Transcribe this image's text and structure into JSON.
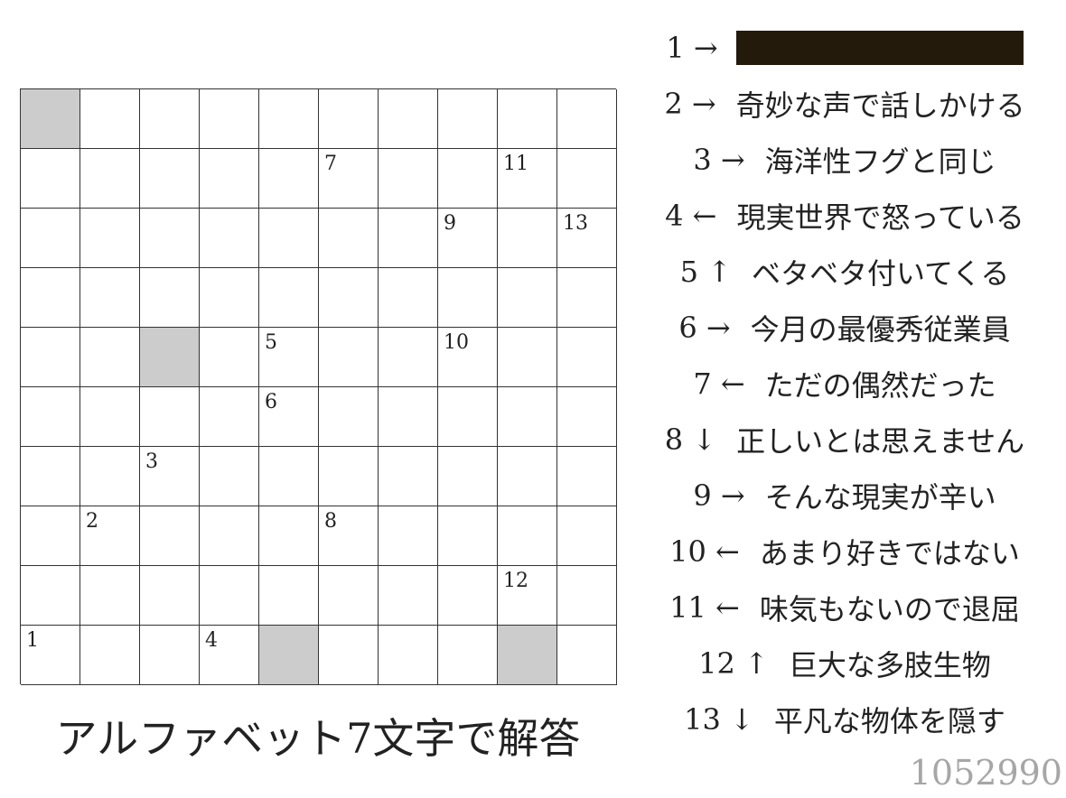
{
  "puzzle": {
    "rows": 10,
    "cols": 10,
    "blocked": [
      [
        0,
        0
      ],
      [
        4,
        2
      ],
      [
        9,
        4
      ],
      [
        9,
        8
      ]
    ],
    "numbers": [
      {
        "r": 1,
        "c": 5,
        "n": "7"
      },
      {
        "r": 1,
        "c": 8,
        "n": "11"
      },
      {
        "r": 2,
        "c": 7,
        "n": "9"
      },
      {
        "r": 2,
        "c": 9,
        "n": "13"
      },
      {
        "r": 4,
        "c": 4,
        "n": "5"
      },
      {
        "r": 4,
        "c": 7,
        "n": "10"
      },
      {
        "r": 5,
        "c": 4,
        "n": "6"
      },
      {
        "r": 6,
        "c": 2,
        "n": "3"
      },
      {
        "r": 7,
        "c": 1,
        "n": "2"
      },
      {
        "r": 7,
        "c": 5,
        "n": "8"
      },
      {
        "r": 8,
        "c": 8,
        "n": "12"
      },
      {
        "r": 9,
        "c": 0,
        "n": "1"
      },
      {
        "r": 9,
        "c": 3,
        "n": "4"
      }
    ]
  },
  "instruction": "アルファベット7文字で解答",
  "clues": [
    {
      "label": "1 →",
      "text": "",
      "redacted": true
    },
    {
      "label": "2 →",
      "text": "奇妙な声で話しかける"
    },
    {
      "label": "3 →",
      "text": "海洋性フグと同じ"
    },
    {
      "label": "4 ←",
      "text": "現実世界で怒っている"
    },
    {
      "label": "5 ↑",
      "text": "ベタベタ付いてくる"
    },
    {
      "label": "6 →",
      "text": "今月の最優秀従業員"
    },
    {
      "label": "7 ←",
      "text": "ただの偶然だった"
    },
    {
      "label": "8 ↓",
      "text": "正しいとは思えません"
    },
    {
      "label": "9 →",
      "text": "そんな現実が辛い"
    },
    {
      "label": "10 ←",
      "text": "あまり好きではない"
    },
    {
      "label": "11 ←",
      "text": "味気もないので退屈"
    },
    {
      "label": "12 ↑",
      "text": "巨大な多肢生物"
    },
    {
      "label": "13 ↓",
      "text": "平凡な物体を隠す"
    }
  ],
  "puzzle_id": "1052990"
}
